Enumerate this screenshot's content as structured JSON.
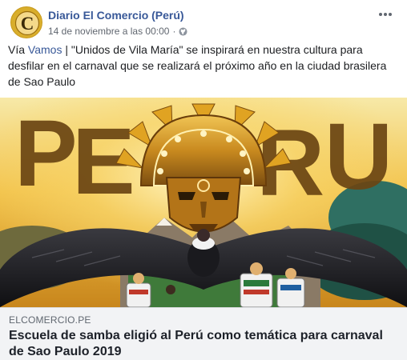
{
  "post": {
    "page_name": "Diario El Comercio (Perú)",
    "timestamp": "14 de noviembre a las 00:00",
    "separator": "·",
    "privacy_icon": "globe-icon",
    "more_icon": "more-options-icon",
    "avatar_letter": "C",
    "text_prefix": "Vía ",
    "text_link": "Vamos",
    "text_body": " | \"Unidos de Vila María\" se inspirará en nuestra cultura para desfilar en el carnaval que se realizará el próximo año en la ciudad brasilera de Sao Paulo"
  },
  "link_preview": {
    "image_letters": [
      "P",
      "E",
      "R",
      "U"
    ],
    "domain": "ELCOMERCIO.PE",
    "headline": "Escuela de samba eligió al Perú como temática para carnaval de Sao Paulo 2019"
  },
  "colors": {
    "link": "#385898",
    "meta": "#616770",
    "link_box_bg": "#f2f3f5",
    "gold": "#e0a322"
  }
}
